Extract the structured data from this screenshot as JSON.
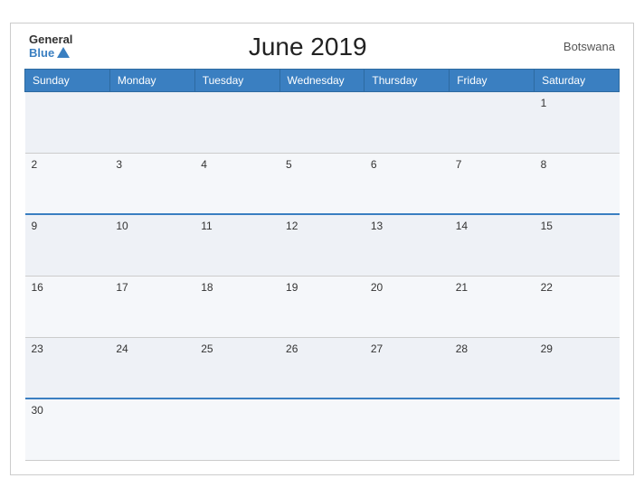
{
  "header": {
    "logo_general": "General",
    "logo_blue": "Blue",
    "title": "June 2019",
    "country": "Botswana"
  },
  "weekdays": [
    "Sunday",
    "Monday",
    "Tuesday",
    "Wednesday",
    "Thursday",
    "Friday",
    "Saturday"
  ],
  "weeks": [
    [
      "",
      "",
      "",
      "",
      "",
      "",
      "1"
    ],
    [
      "2",
      "3",
      "4",
      "5",
      "6",
      "7",
      "8"
    ],
    [
      "9",
      "10",
      "11",
      "12",
      "13",
      "14",
      "15"
    ],
    [
      "16",
      "17",
      "18",
      "19",
      "20",
      "21",
      "22"
    ],
    [
      "23",
      "24",
      "25",
      "26",
      "27",
      "28",
      "29"
    ],
    [
      "30",
      "",
      "",
      "",
      "",
      "",
      ""
    ]
  ]
}
